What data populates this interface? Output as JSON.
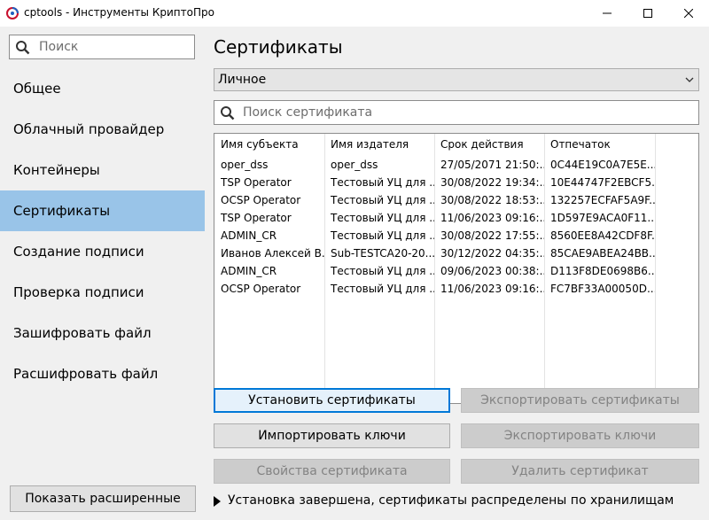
{
  "window": {
    "title": "cptools - Инструменты КриптоПро"
  },
  "sidebar": {
    "search_placeholder": "Поиск",
    "items": [
      {
        "label": "Общее",
        "active": false
      },
      {
        "label": "Облачный провайдер",
        "active": false
      },
      {
        "label": "Контейнеры",
        "active": false
      },
      {
        "label": "Сертификаты",
        "active": true
      },
      {
        "label": "Создание подписи",
        "active": false
      },
      {
        "label": "Проверка подписи",
        "active": false
      },
      {
        "label": "Зашифровать файл",
        "active": false
      },
      {
        "label": "Расшифровать файл",
        "active": false
      }
    ],
    "advanced_button": "Показать расширенные"
  },
  "main": {
    "title": "Сертификаты",
    "store_select": {
      "value": "Личное"
    },
    "search_placeholder": "Поиск сертификата",
    "table": {
      "columns": [
        "Имя субъекта",
        "Имя издателя",
        "Срок действия",
        "Отпечаток"
      ],
      "rows": [
        [
          "oper_dss",
          "oper_dss",
          "27/05/2071 21:50:...",
          "0C44E19C0A7E5E..."
        ],
        [
          "TSP Operator",
          "Тестовый УЦ для ...",
          "30/08/2022 19:34:...",
          "10E44747F2EBCF5..."
        ],
        [
          "OCSP Operator",
          "Тестовый УЦ для ...",
          "30/08/2022 18:53:...",
          "132257ECFAF5A9F..."
        ],
        [
          "TSP Operator",
          "Тестовый УЦ для ...",
          "11/06/2023 09:16:...",
          "1D597E9ACA0F11..."
        ],
        [
          "ADMIN_CR",
          "Тестовый УЦ для ...",
          "30/08/2022 17:55:...",
          "8560EE8A42CDF8F..."
        ],
        [
          "Иванов Алексей В...",
          "Sub-TESTCA20-20...",
          "30/12/2022 04:35:...",
          "85CAE9ABEA24BB..."
        ],
        [
          "ADMIN_CR",
          "Тестовый УЦ для ...",
          "09/06/2023 00:38:...",
          "D113F8DE0698B6..."
        ],
        [
          "OCSP Operator",
          "Тестовый УЦ для ...",
          "11/06/2023 09:16:...",
          "FC7BF33A00050D..."
        ]
      ]
    },
    "buttons": {
      "install": "Установить сертификаты",
      "export_certs": "Экспортировать сертификаты",
      "import_keys": "Импортировать ключи",
      "export_keys": "Экспортировать ключи",
      "properties": "Свойства сертификата",
      "delete": "Удалить сертификат"
    },
    "status": "Установка завершена, сертификаты распределены по хранилищам"
  },
  "colors": {
    "active_nav": "#99c4e8",
    "focus_border": "#0078d7",
    "panel_bg": "#f0f0f0"
  }
}
